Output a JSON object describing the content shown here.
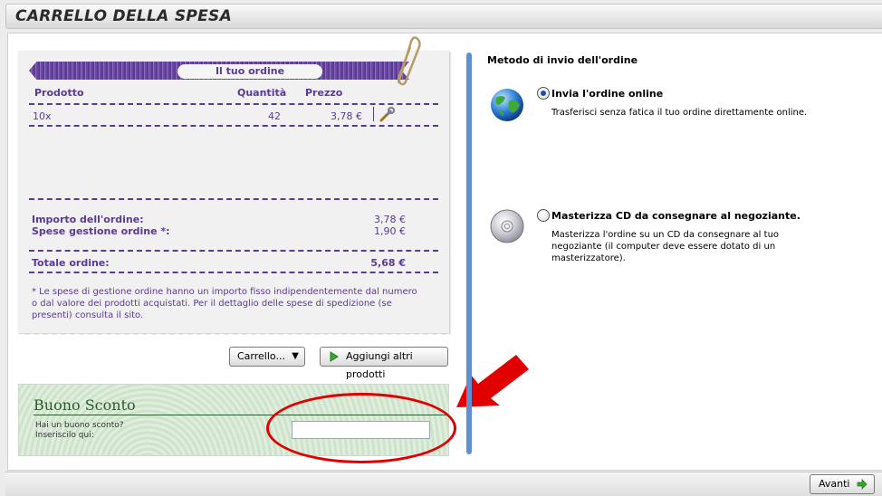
{
  "header": {
    "title": "CARRELLO DELLA SPESA"
  },
  "order": {
    "band_label": "Il tuo ordine",
    "columns": {
      "product": "Prodotto",
      "quantity": "Quantità",
      "price": "Prezzo"
    },
    "rows": [
      {
        "product": "10x",
        "quantity": "42",
        "price": "3,78 €"
      }
    ],
    "summary": {
      "amount_label": "Importo dell'ordine:",
      "amount_value": "3,78 €",
      "fee_label": "Spese gestione ordine *:",
      "fee_value": "1,90 €",
      "total_label": "Totale ordine:",
      "total_value": "5,68 €"
    },
    "note": "* Le spese di gestione ordine hanno un importo fisso indipendentemente dal numero o dal valore dei prodotti acquistati. Per il dettaglio delle spese di spedizione (se presenti) consulta il sito."
  },
  "actions": {
    "cart_select": "Carrello...",
    "add_products": "Aggiungi altri prodotti",
    "next": "Avanti"
  },
  "coupon": {
    "title": "Buono Sconto",
    "question": "Hai un buono sconto?",
    "prompt": "Inseriscilo qui:",
    "value": ""
  },
  "shipping": {
    "title": "Metodo di invio dell'ordine",
    "options": [
      {
        "label": "Invia l'ordine online",
        "description": "Trasferisci senza fatica il tuo ordine direttamente online.",
        "selected": true,
        "icon": "globe-icon"
      },
      {
        "label": "Masterizza CD da consegnare al negoziante.",
        "description": "Masterizza l'ordine su un CD da consegnare al tuo negoziante (il computer deve essere dotato di un masterizzatore).",
        "selected": false,
        "icon": "cd-icon"
      }
    ]
  },
  "colors": {
    "accent": "#5b3a92",
    "divider": "#5f8fd0",
    "highlight": "#e00000",
    "coupon": "#2d5a2d"
  }
}
